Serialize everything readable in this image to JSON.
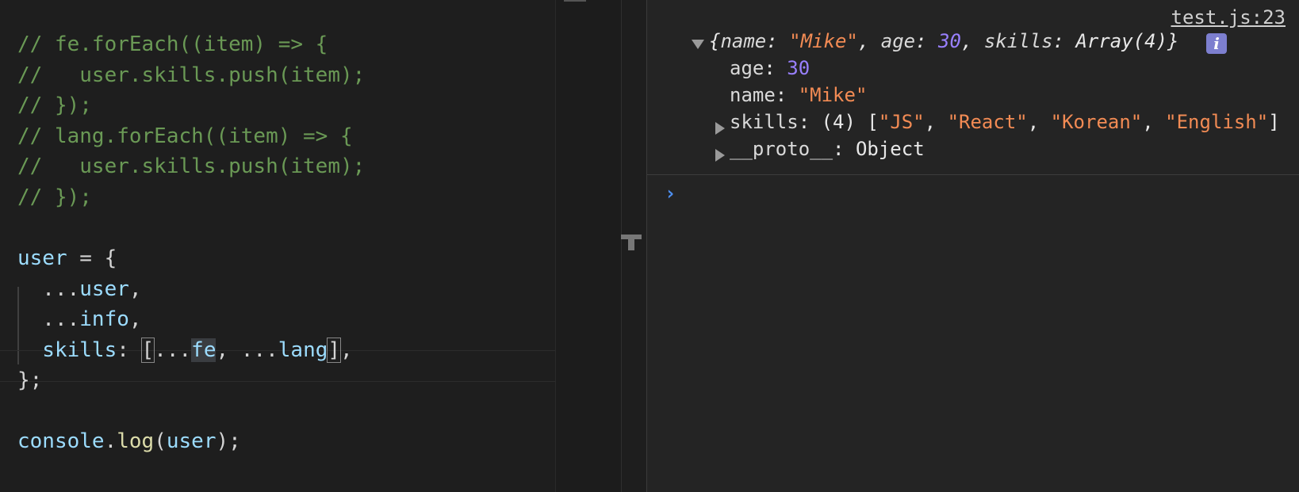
{
  "editor": {
    "lines": [
      {
        "kind": "comment",
        "text": "// fe.forEach((item) => {"
      },
      {
        "kind": "comment",
        "text": "//   user.skills.push(item);"
      },
      {
        "kind": "comment",
        "text": "// });"
      },
      {
        "kind": "comment",
        "text": "// lang.forEach((item) => {"
      },
      {
        "kind": "comment",
        "text": "//   user.skills.push(item);"
      },
      {
        "kind": "comment",
        "text": "// });"
      }
    ],
    "code": {
      "user_var": "user",
      "assign_open": " = {",
      "spread_user_prefix": "  ...",
      "spread_user_name": "user",
      "spread_user_suffix": ",",
      "spread_info_prefix": "  ...",
      "spread_info_name": "info",
      "spread_info_suffix": ",",
      "skills_key": "  skills",
      "skills_colon": ": ",
      "bracket_open": "[",
      "spread_fe_dots": "...",
      "fe_name": "fe",
      "comma_space": ", ",
      "spread_lang_dots": "...",
      "lang_name": "lang",
      "bracket_close": "]",
      "skills_trailing": ",",
      "close_obj": "};",
      "console_obj": "console",
      "dot": ".",
      "log_fn": "log",
      "paren_open": "(",
      "log_arg": "user",
      "paren_close_semi": ");"
    }
  },
  "console": {
    "source_link": "test.js:23",
    "summary": {
      "open": "{",
      "name_key": "name",
      "name_val": "\"Mike\"",
      "age_key": "age",
      "age_val": "30",
      "skills_key": "skills",
      "skills_val": "Array(4)",
      "close": "}"
    },
    "info_badge": "i",
    "props": {
      "age_key": "age",
      "age_val": "30",
      "name_key": "name",
      "name_val": "\"Mike\"",
      "skills_key": "skills",
      "skills_count": "(4)",
      "skills_items": [
        "\"JS\"",
        "\"React\"",
        "\"Korean\"",
        "\"English\""
      ],
      "proto_key": "__proto__",
      "proto_val": "Object"
    },
    "prompt_symbol": "›"
  },
  "colors": {
    "comment": "#6a9955",
    "variable": "#9cdcfe",
    "function": "#dcdcaa",
    "string": "#f28b54",
    "number": "#9980ff",
    "prompt": "#4d8ff0"
  }
}
